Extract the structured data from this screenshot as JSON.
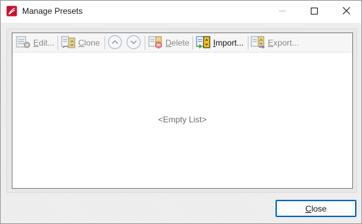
{
  "window": {
    "title": "Manage Presets",
    "icons": {
      "app": "foxit-pdf-icon",
      "minimize": "minimize-icon",
      "maximize": "maximize-icon",
      "close": "close-icon"
    }
  },
  "toolbar": {
    "edit": {
      "label_pre": "",
      "label_ul": "E",
      "label_post": "dit...",
      "enabled": false,
      "icon": "edit-preset-icon"
    },
    "clone": {
      "label_pre": "",
      "label_ul": "C",
      "label_post": "lone",
      "enabled": false,
      "icon": "clone-preset-icon"
    },
    "move_up": {
      "enabled": false,
      "icon": "arrow-up-circle-icon"
    },
    "move_down": {
      "enabled": false,
      "icon": "arrow-down-circle-icon"
    },
    "delete": {
      "label_pre": "",
      "label_ul": "D",
      "label_post": "elete",
      "enabled": false,
      "icon": "delete-preset-icon"
    },
    "import": {
      "label_pre": "",
      "label_ul": "I",
      "label_post": "mport...",
      "enabled": true,
      "icon": "import-preset-icon"
    },
    "export": {
      "label_pre": "",
      "label_ul": "E",
      "label_post": "xport...",
      "enabled": false,
      "icon": "export-preset-icon"
    }
  },
  "list": {
    "empty_text": "<Empty List>"
  },
  "footer": {
    "close_ul": "C",
    "close_post": "lose"
  },
  "colors": {
    "accent": "#0067c0",
    "brand": "#c8102e"
  }
}
